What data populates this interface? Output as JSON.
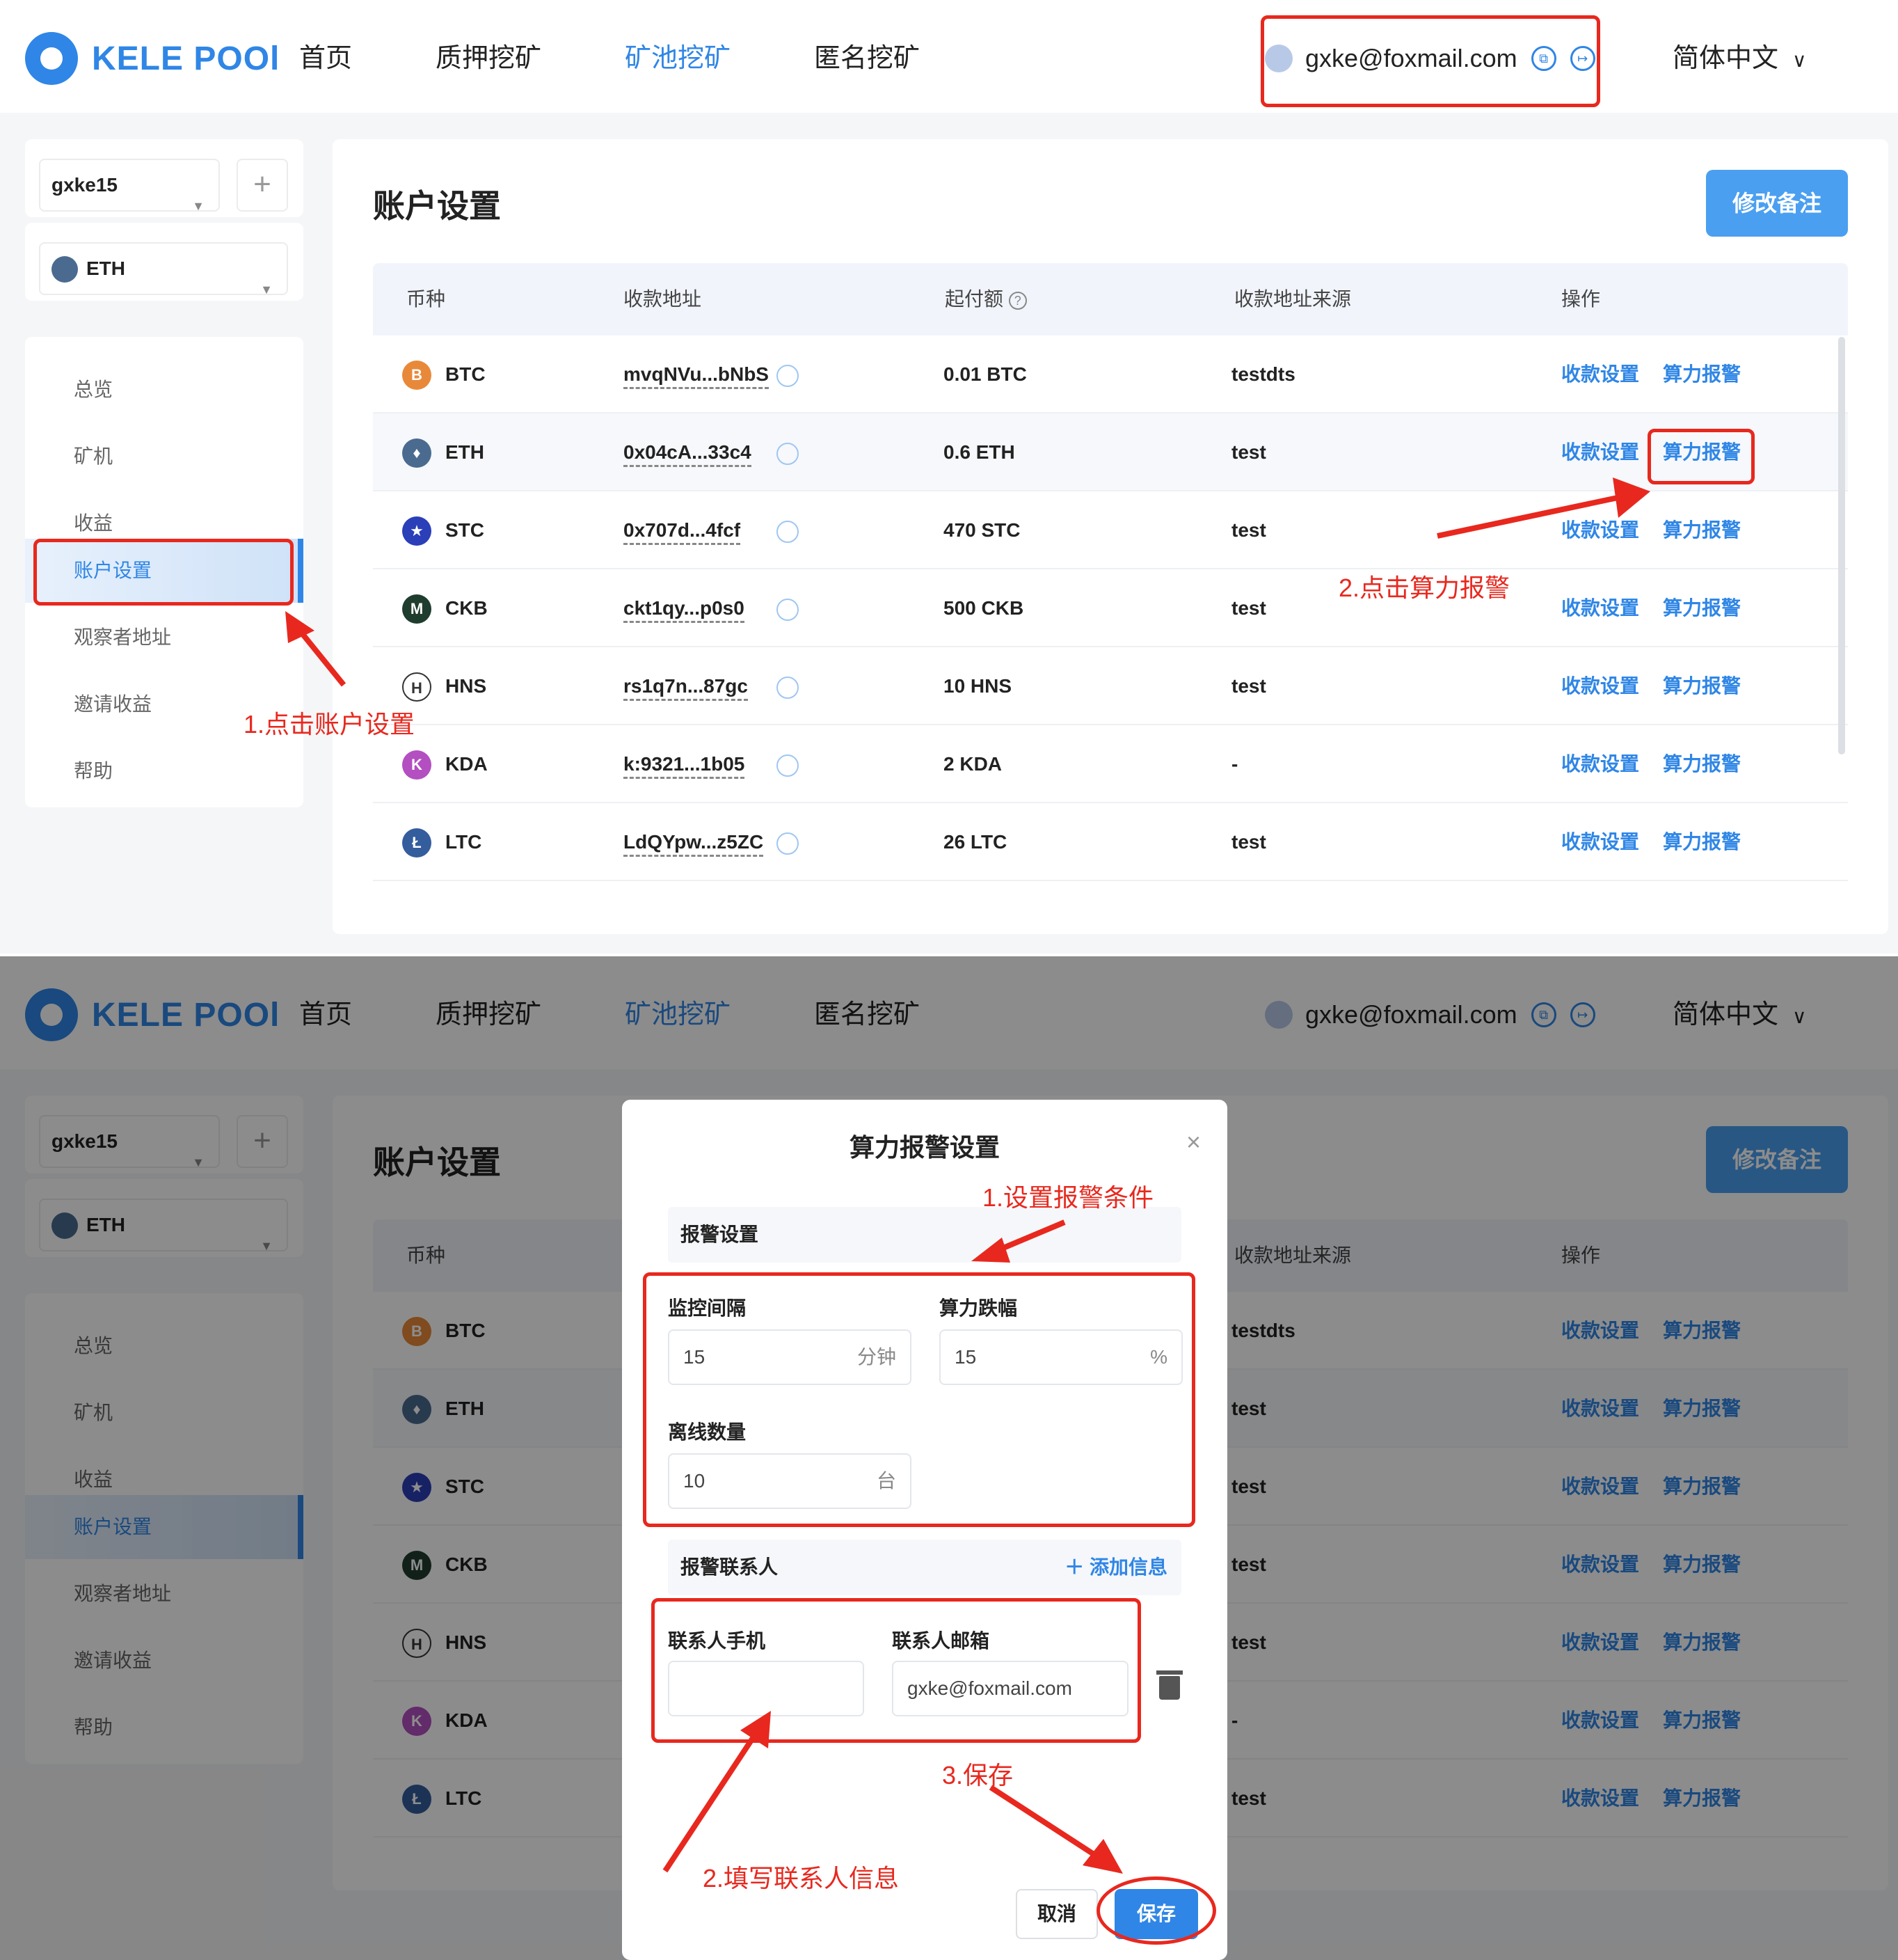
{
  "header": {
    "logo_text": "KELE POOl",
    "nav": [
      "首页",
      "质押挖矿",
      "矿池挖矿",
      "匿名挖矿"
    ],
    "active_nav": 2,
    "user_email": "gxke@foxmail.com",
    "language": "简体中文"
  },
  "sidebar": {
    "account": "gxke15",
    "coin": "ETH",
    "menu": [
      "总览",
      "矿机",
      "收益",
      "账户设置",
      "观察者地址",
      "邀请收益",
      "帮助"
    ],
    "active_menu": 3
  },
  "main": {
    "title": "账户设置",
    "remark_button": "修改备注",
    "columns": [
      "币种",
      "收款地址",
      "起付额",
      "收款地址来源",
      "操作"
    ],
    "rows": [
      {
        "coin": "BTC",
        "address": "mvqNVu...bNbS",
        "min": "0.01 BTC",
        "source": "testdts",
        "icon_color": "#e8893a",
        "icon_glyph": "B"
      },
      {
        "coin": "ETH",
        "address": "0x04cA...33c4",
        "min": "0.6 ETH",
        "source": "test",
        "icon_color": "#4a6b8f",
        "icon_glyph": "♦"
      },
      {
        "coin": "STC",
        "address": "0x707d...4fcf",
        "min": "470 STC",
        "source": "test",
        "icon_color": "#2a3fb8",
        "icon_glyph": "★"
      },
      {
        "coin": "CKB",
        "address": "ckt1qy...p0s0",
        "min": "500 CKB",
        "source": "test",
        "icon_color": "#1f3d2e",
        "icon_glyph": "M"
      },
      {
        "coin": "HNS",
        "address": "rs1q7n...87gc",
        "min": "10 HNS",
        "source": "test",
        "icon_color": "#ffffff",
        "icon_glyph": "H"
      },
      {
        "coin": "KDA",
        "address": "k:9321...1b05",
        "min": "2 KDA",
        "source": "-",
        "icon_color": "#b34fc0",
        "icon_glyph": "K"
      },
      {
        "coin": "LTC",
        "address": "LdQYpw...z5ZC",
        "min": "26 LTC",
        "source": "test",
        "icon_color": "#345d9d",
        "icon_glyph": "Ł"
      }
    ],
    "op_payment": "收款设置",
    "op_alert": "算力报警"
  },
  "annotations_top": {
    "step1": "1.点击账户设置",
    "step2": "2.点击算力报警"
  },
  "modal": {
    "title": "算力报警设置",
    "close": "×",
    "section_alert": "报警设置",
    "interval_label": "监控间隔",
    "interval_value": "15",
    "interval_unit": "分钟",
    "drop_label": "算力跌幅",
    "drop_value": "15",
    "drop_unit": "%",
    "offline_label": "离线数量",
    "offline_value": "10",
    "offline_unit": "台",
    "section_contact": "报警联系人",
    "add_info": "添加信息",
    "phone_label": "联系人手机",
    "phone_value": "",
    "email_label": "联系人邮箱",
    "email_value": "gxke@foxmail.com",
    "cancel": "取消",
    "save": "保存"
  },
  "annotations_bottom": {
    "step1": "1.设置报警条件",
    "step2": "2.填写联系人信息",
    "step3": "3.保存"
  }
}
